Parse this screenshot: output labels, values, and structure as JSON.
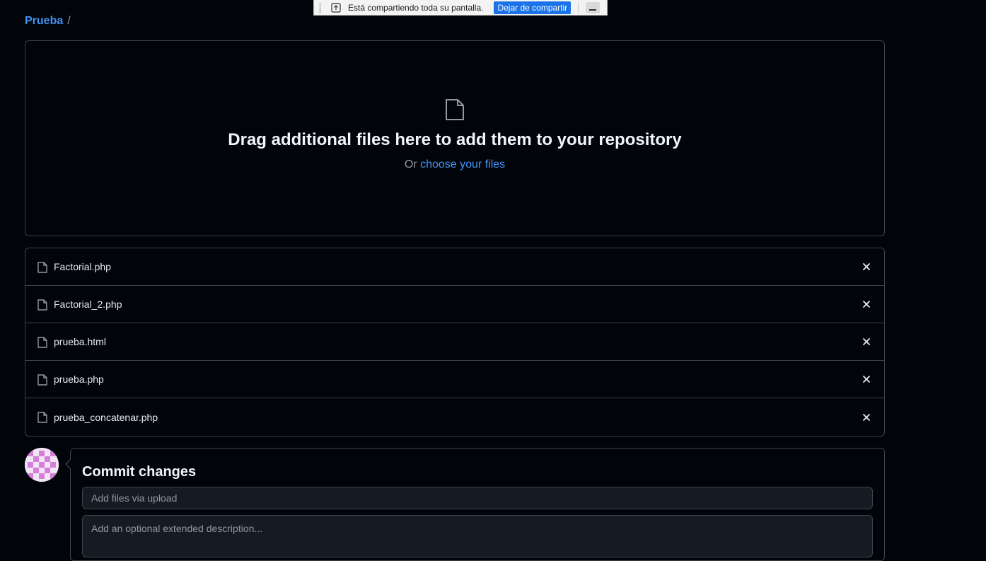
{
  "share_bar": {
    "message": "Está compartiendo toda su pantalla.",
    "stop_label": "Dejar de compartir",
    "icons": [
      "grip-icon",
      "share-upload-icon",
      "minimize-icon"
    ]
  },
  "breadcrumb": {
    "repo": "Prueba",
    "separator": "/"
  },
  "dropzone": {
    "icon": "file-icon",
    "headline": "Drag additional files here to add them to your repository",
    "or_text": "Or",
    "choose_link": "choose your files"
  },
  "files": [
    {
      "name": "Factorial.php"
    },
    {
      "name": "Factorial_2.php"
    },
    {
      "name": "prueba.html"
    },
    {
      "name": "prueba.php"
    },
    {
      "name": "prueba_concatenar.php"
    }
  ],
  "commit": {
    "title": "Commit changes",
    "summary_placeholder": "Add files via upload",
    "description_placeholder": "Add an optional extended description..."
  },
  "colors": {
    "background": "#010409",
    "border": "#3d444d",
    "link": "#4493f8",
    "avatar": "#d47fd9",
    "share_button": "#1a73e8"
  }
}
